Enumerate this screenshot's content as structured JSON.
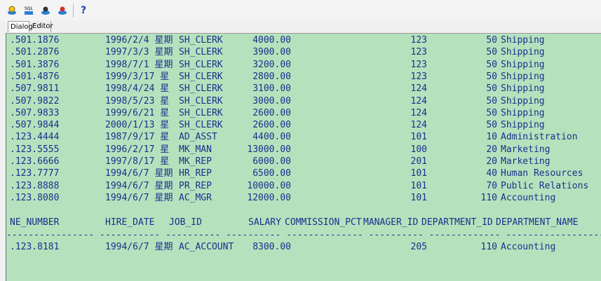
{
  "toolbar": {
    "icons": [
      "run-icon",
      "sql-icon",
      "db-icon",
      "db-alt-icon"
    ],
    "help_label": "?"
  },
  "tabs": [
    {
      "label": "Dialog",
      "active": true
    },
    {
      "label": "Editor",
      "active": false
    }
  ],
  "rows": [
    {
      "phone": ".501.1876",
      "date": "1996/2/4 星期",
      "job": "SH_CLERK",
      "salary": "4000.00",
      "mgr": "123",
      "dept_id": "50",
      "dept": "Shipping"
    },
    {
      "phone": ".501.2876",
      "date": "1997/3/3 星期",
      "job": "SH_CLERK",
      "salary": "3900.00",
      "mgr": "123",
      "dept_id": "50",
      "dept": "Shipping"
    },
    {
      "phone": ".501.3876",
      "date": "1998/7/1 星期",
      "job": "SH_CLERK",
      "salary": "3200.00",
      "mgr": "123",
      "dept_id": "50",
      "dept": "Shipping"
    },
    {
      "phone": ".501.4876",
      "date": "1999/3/17 星",
      "job": "SH_CLERK",
      "salary": "2800.00",
      "mgr": "123",
      "dept_id": "50",
      "dept": "Shipping"
    },
    {
      "phone": ".507.9811",
      "date": "1998/4/24 星",
      "job": "SH_CLERK",
      "salary": "3100.00",
      "mgr": "124",
      "dept_id": "50",
      "dept": "Shipping"
    },
    {
      "phone": ".507.9822",
      "date": "1998/5/23 星",
      "job": "SH_CLERK",
      "salary": "3000.00",
      "mgr": "124",
      "dept_id": "50",
      "dept": "Shipping"
    },
    {
      "phone": ".507.9833",
      "date": "1999/6/21 星",
      "job": "SH_CLERK",
      "salary": "2600.00",
      "mgr": "124",
      "dept_id": "50",
      "dept": "Shipping"
    },
    {
      "phone": ".507.9844",
      "date": "2000/1/13 星",
      "job": "SH_CLERK",
      "salary": "2600.00",
      "mgr": "124",
      "dept_id": "50",
      "dept": "Shipping"
    },
    {
      "phone": ".123.4444",
      "date": "1987/9/17 星",
      "job": "AD_ASST",
      "salary": "4400.00",
      "mgr": "101",
      "dept_id": "10",
      "dept": "Administration"
    },
    {
      "phone": ".123.5555",
      "date": "1996/2/17 星",
      "job": "MK_MAN",
      "salary": "13000.00",
      "mgr": "100",
      "dept_id": "20",
      "dept": "Marketing"
    },
    {
      "phone": ".123.6666",
      "date": "1997/8/17 星",
      "job": "MK_REP",
      "salary": "6000.00",
      "mgr": "201",
      "dept_id": "20",
      "dept": "Marketing"
    },
    {
      "phone": ".123.7777",
      "date": "1994/6/7 星期",
      "job": "HR_REP",
      "salary": "6500.00",
      "mgr": "101",
      "dept_id": "40",
      "dept": "Human Resources"
    },
    {
      "phone": ".123.8888",
      "date": "1994/6/7 星期",
      "job": "PR_REP",
      "salary": "10000.00",
      "mgr": "101",
      "dept_id": "70",
      "dept": "Public Relations"
    },
    {
      "phone": ".123.8080",
      "date": "1994/6/7 星期",
      "job": "AC_MGR",
      "salary": "12000.00",
      "mgr": "101",
      "dept_id": "110",
      "dept": "Accounting"
    }
  ],
  "header": {
    "phone": "NE_NUMBER",
    "date": "HIRE_DATE",
    "job": "JOB_ID",
    "salary": "SALARY",
    "commission": "COMMISSION_PCT",
    "mgr": "MANAGER_ID",
    "dept_id": "DEPARTMENT_ID",
    "dept": "DEPARTMENT_NAME"
  },
  "separator": "---------------- ----------- ---------- ---------- -------------- ---------- ------------- --------------------",
  "last_row": {
    "phone": ".123.8181",
    "date": "1994/6/7 星期",
    "job": "AC_ACCOUNT",
    "salary": "8300.00",
    "mgr": "205",
    "dept_id": "110",
    "dept": "Accounting"
  }
}
